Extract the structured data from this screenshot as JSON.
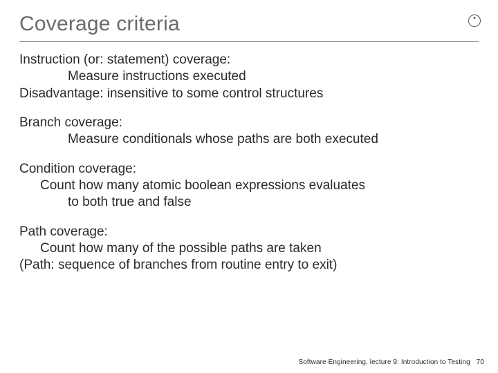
{
  "title": "Coverage criteria",
  "logo": {
    "name": "ring-icon"
  },
  "sections": [
    {
      "lead": "Instruction (or: statement) coverage:",
      "detail": "Measure instructions executed",
      "tail": "Disadvantage: insensitive to some control structures"
    },
    {
      "lead": "Branch coverage:",
      "detail": "Measure conditionals whose paths are both executed"
    },
    {
      "lead": "Condition coverage:",
      "detail_a": "Count how many atomic boolean expressions evaluates",
      "detail_b": "to both true and false"
    },
    {
      "lead": "Path coverage:",
      "detail": "Count how many of the possible paths are taken",
      "tail": "(Path: sequence of branches from routine entry to exit)"
    }
  ],
  "footer": {
    "text": "Software Engineering, lecture 9: Introduction to Testing",
    "page": "70"
  }
}
